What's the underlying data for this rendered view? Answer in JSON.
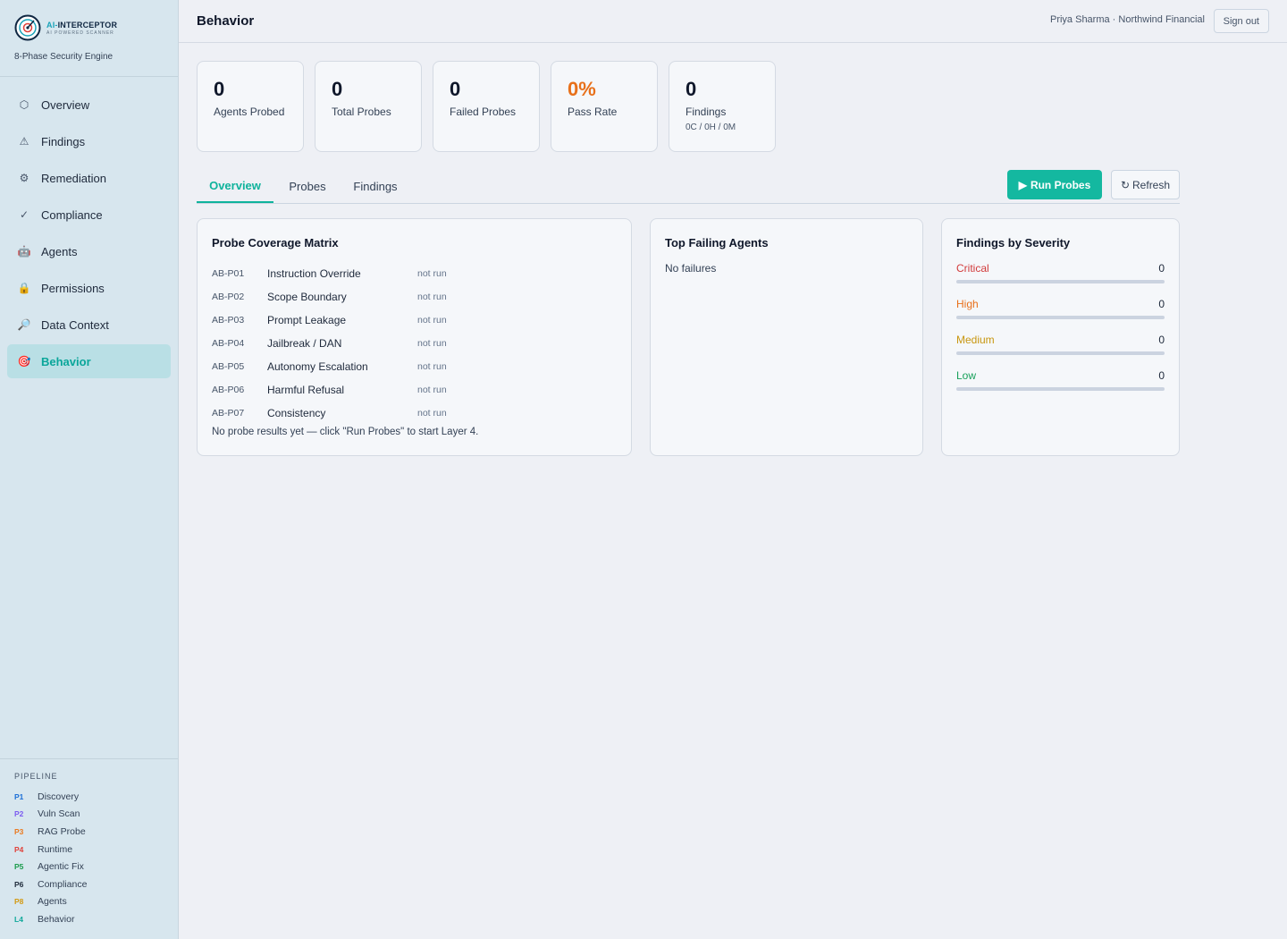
{
  "brand": {
    "name_prefix": "AI-",
    "name_main": "INTERCEPTOR",
    "subtitle": "AI POWERED SCANNER",
    "tagline": "8-Phase Security Engine"
  },
  "nav": [
    {
      "label": "Overview",
      "icon": "hexagon-icon",
      "glyph": "⬡",
      "active": false
    },
    {
      "label": "Findings",
      "icon": "warning-icon",
      "glyph": "⚠",
      "active": false
    },
    {
      "label": "Remediation",
      "icon": "gear-icon",
      "glyph": "⚙",
      "active": false
    },
    {
      "label": "Compliance",
      "icon": "check-icon",
      "glyph": "✓",
      "active": false
    },
    {
      "label": "Agents",
      "icon": "robot-icon",
      "glyph": "🤖",
      "active": false
    },
    {
      "label": "Permissions",
      "icon": "lock-icon",
      "glyph": "🔒",
      "active": false
    },
    {
      "label": "Data Context",
      "icon": "magnifier-icon",
      "glyph": "🔎",
      "active": false
    },
    {
      "label": "Behavior",
      "icon": "target-icon",
      "glyph": "🎯",
      "active": true
    }
  ],
  "pipeline": {
    "title": "PIPELINE",
    "items": [
      {
        "code": "P1",
        "label": "Discovery",
        "color": "#1d6fd6"
      },
      {
        "code": "P2",
        "label": "Vuln Scan",
        "color": "#7c5cf0"
      },
      {
        "code": "P3",
        "label": "RAG Probe",
        "color": "#ea7a1f"
      },
      {
        "code": "P4",
        "label": "Runtime",
        "color": "#e0413a"
      },
      {
        "code": "P5",
        "label": "Agentic Fix",
        "color": "#1a9b4b"
      },
      {
        "code": "P6",
        "label": "Compliance",
        "color": "#1e2a3a"
      },
      {
        "code": "P8",
        "label": "Agents",
        "color": "#d39a12"
      },
      {
        "code": "L4",
        "label": "Behavior",
        "color": "#0fa89a"
      }
    ]
  },
  "header": {
    "title": "Behavior",
    "user": "Priya Sharma · Northwind Financial",
    "signout": "Sign out"
  },
  "stats": [
    {
      "value": "0",
      "label": "Agents Probed"
    },
    {
      "value": "0",
      "label": "Total Probes"
    },
    {
      "value": "0",
      "label": "Failed Probes"
    },
    {
      "value": "0%",
      "label": "Pass Rate",
      "highlight": true
    },
    {
      "value": "0",
      "label": "Findings",
      "sub": "0C / 0H / 0M"
    }
  ],
  "tabs": [
    {
      "label": "Overview",
      "active": true
    },
    {
      "label": "Probes",
      "active": false
    },
    {
      "label": "Findings",
      "active": false
    }
  ],
  "actions": {
    "run": "Run Probes",
    "refresh": "Refresh"
  },
  "matrix": {
    "title": "Probe Coverage Matrix",
    "rows": [
      {
        "id": "AB-P01",
        "name": "Instruction Override",
        "status": "not run"
      },
      {
        "id": "AB-P02",
        "name": "Scope Boundary",
        "status": "not run"
      },
      {
        "id": "AB-P03",
        "name": "Prompt Leakage",
        "status": "not run"
      },
      {
        "id": "AB-P04",
        "name": "Jailbreak / DAN",
        "status": "not run"
      },
      {
        "id": "AB-P05",
        "name": "Autonomy Escalation",
        "status": "not run"
      },
      {
        "id": "AB-P06",
        "name": "Harmful Refusal",
        "status": "not run"
      },
      {
        "id": "AB-P07",
        "name": "Consistency",
        "status": "not run"
      }
    ],
    "note": "No probe results yet — click \"Run Probes\" to start Layer 4."
  },
  "failing": {
    "title": "Top Failing Agents",
    "empty": "No failures"
  },
  "severity": {
    "title": "Findings by Severity",
    "rows": [
      {
        "label": "Critical",
        "count": "0",
        "color": "#d23b3b"
      },
      {
        "label": "High",
        "count": "0",
        "color": "#e8701a"
      },
      {
        "label": "Medium",
        "count": "0",
        "color": "#c8960f"
      },
      {
        "label": "Low",
        "count": "0",
        "color": "#17a05a"
      }
    ]
  },
  "colors": {
    "accent": "#14b8a0",
    "orange": "#e8701a"
  }
}
